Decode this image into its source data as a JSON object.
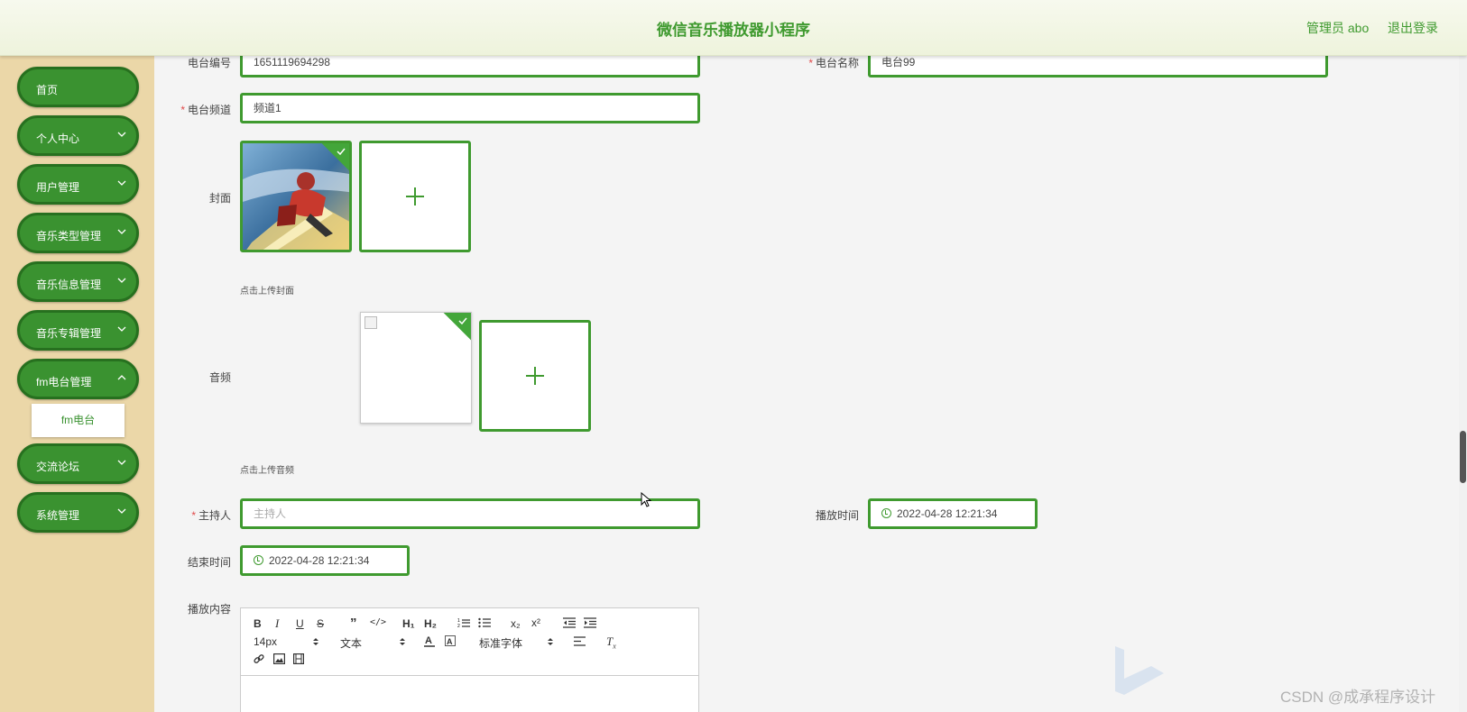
{
  "header": {
    "title": "微信音乐播放器小程序",
    "admin": "管理员 abo",
    "logout": "退出登录"
  },
  "sidebar": {
    "items": [
      {
        "label": "首页"
      },
      {
        "label": "个人中心"
      },
      {
        "label": "用户管理"
      },
      {
        "label": "音乐类型管理"
      },
      {
        "label": "音乐信息管理"
      },
      {
        "label": "音乐专辑管理"
      },
      {
        "label": "fm电台管理"
      },
      {
        "label": "交流论坛"
      },
      {
        "label": "系统管理"
      }
    ],
    "subitem": "fm电台"
  },
  "form": {
    "station_no": {
      "label": "电台编号",
      "value": "1651119694298"
    },
    "station_name": {
      "label": "电台名称",
      "value": "电台99"
    },
    "channel": {
      "label": "电台频道",
      "value": "频道1"
    },
    "cover": {
      "label": "封面",
      "hint": "点击上传封面"
    },
    "audio": {
      "label": "音频",
      "hint": "点击上传音频"
    },
    "host": {
      "label": "主持人",
      "placeholder": "主持人"
    },
    "play_time": {
      "label": "播放时间",
      "value": "2022-04-28 12:21:34"
    },
    "end_time": {
      "label": "结束时间",
      "value": "2022-04-28 12:21:34"
    },
    "content": {
      "label": "播放内容"
    }
  },
  "editor": {
    "font_size": "14px",
    "paragraph": "文本",
    "font_family": "标准字体"
  },
  "watermark": "CSDN @成承程序设计",
  "colors": {
    "accent": "#3f9a2f",
    "sidebar_bg": "#ebd7a8",
    "page_bg": "#f4f4f4"
  }
}
